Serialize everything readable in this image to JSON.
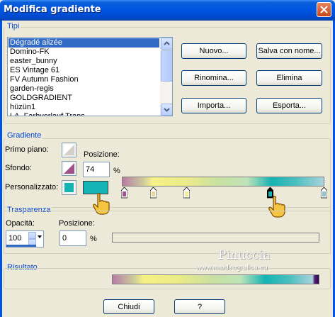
{
  "window": {
    "title": "Modifica gradiente"
  },
  "tipi": {
    "group_label": "Tipi",
    "list_items": [
      "Dégradé alizée",
      "Domino-FK",
      "easter_bunny",
      "ES Vintage 61",
      "FV Autumn Fashion",
      "garden-regis",
      "GOLDGRADIENT",
      "hüzün1",
      "LA_Farbverlauf Trans"
    ],
    "selected_index": 0,
    "buttons": {
      "nuovo": "Nuovo...",
      "salva": "Salva con nome...",
      "rinomina": "Rinomina...",
      "elimina": "Elimina",
      "importa": "Importa...",
      "esporta": "Esporta..."
    }
  },
  "gradiente": {
    "group_label": "Gradiente",
    "primo_piano": "Primo piano:",
    "sfondo": "Sfondo:",
    "personalizzato": "Personalizzato:",
    "posizione_label": "Posizione:",
    "posizione_value": "74",
    "percent": "%",
    "custom_color": "#14b4b4"
  },
  "trasparenza": {
    "group_label": "Trasparenza",
    "opacita_label": "Opacità:",
    "opacita_value": "100",
    "posizione_label": "Posizione:",
    "posizione_value": "0",
    "percent": "%"
  },
  "risultato": {
    "group_label": "Risultato"
  },
  "watermark": {
    "name": "Pinuccia",
    "url": "www.maidiregrafica.eu"
  },
  "footer": {
    "chiudi": "Chiudi",
    "help": "?"
  },
  "colors": {
    "selection": "#316ac5",
    "group_label": "#0046d5",
    "title_blue": "#0054e3"
  }
}
